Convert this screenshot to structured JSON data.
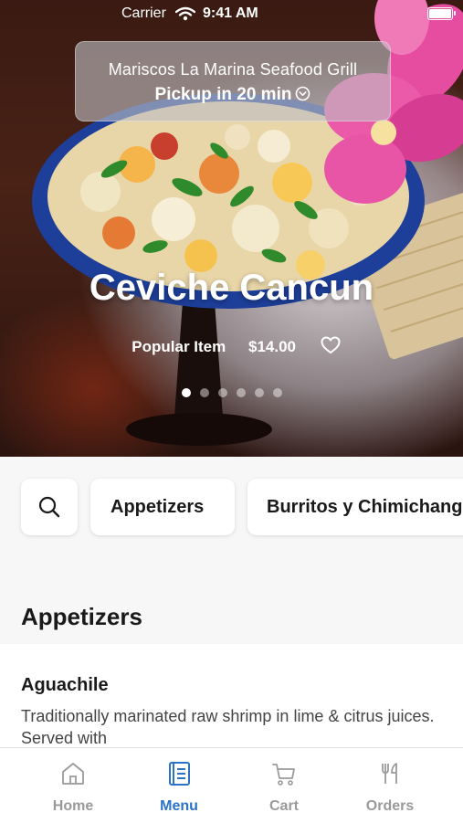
{
  "status_bar": {
    "carrier": "Carrier",
    "time": "9:41 AM"
  },
  "header": {
    "restaurant": "Mariscos La Marina Seafood Grill",
    "pickup": "Pickup in 20 min"
  },
  "featured": {
    "title": "Ceviche Cancun",
    "badge": "Popular Item",
    "price": "$14.00",
    "slide_index": 1,
    "slide_count": 6
  },
  "categories": {
    "items": [
      "Appetizers",
      "Burritos y Chimichangas"
    ]
  },
  "section": {
    "title": "Appetizers"
  },
  "menu_items": [
    {
      "name": "Aguachile",
      "description": "Traditionally marinated raw shrimp in lime & citrus juices. Served with"
    }
  ],
  "tabs": [
    {
      "label": "Home",
      "icon": "home-icon",
      "active": false
    },
    {
      "label": "Menu",
      "icon": "menu-book-icon",
      "active": true
    },
    {
      "label": "Cart",
      "icon": "cart-icon",
      "active": false
    },
    {
      "label": "Orders",
      "icon": "fork-knife-icon",
      "active": false
    }
  ],
  "colors": {
    "accent": "#2a73c7",
    "inactive_tab": "#9a9a9a"
  }
}
